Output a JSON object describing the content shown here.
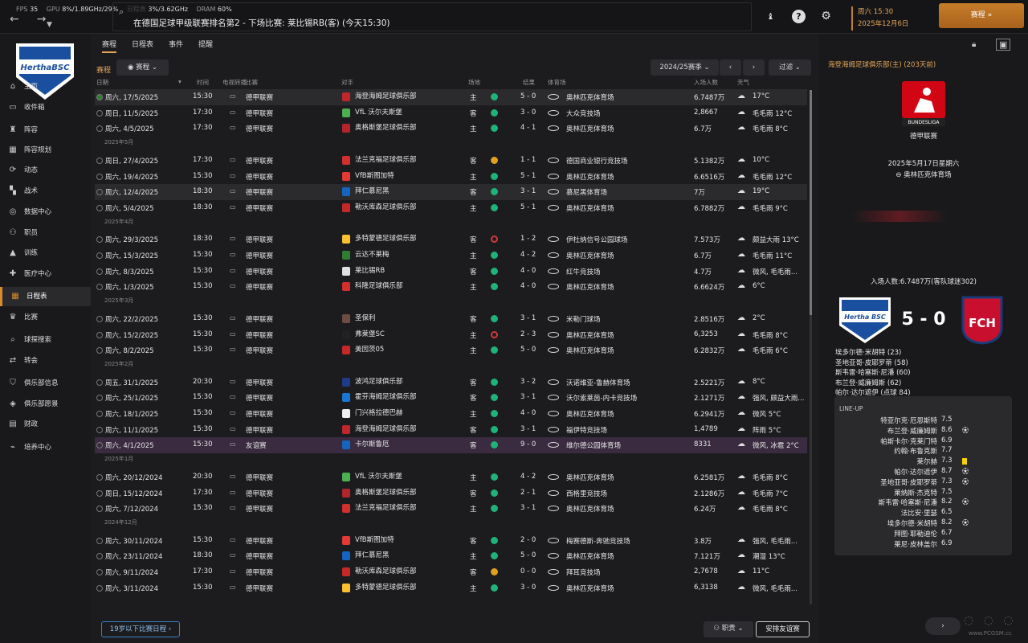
{
  "topbar": {
    "fps_label": "FPS",
    "fps_value": "35",
    "gpu_label": "GPU",
    "gpu_value": "8%/1.89GHz/29%",
    "gpu_mem_value": "3%/3.62GHz",
    "dram_label": "DRAM",
    "dram_value": "60%",
    "faded_text": "日程表",
    "headline": "在德国足球甲级联赛排名第2 - 下场比赛: 莱比锡RB(客) (今天15:30)",
    "weekday_time": "周六 15:30",
    "date": "2025年12月6日",
    "continue_label": "赛程",
    "continue_arrows": "»"
  },
  "sidebar": {
    "items": [
      {
        "label": "主页",
        "icon": "home-icon",
        "glyph": "⌂"
      },
      {
        "label": "收件箱",
        "icon": "inbox-icon",
        "glyph": "▭"
      },
      {
        "label": "阵容",
        "icon": "shirt-icon",
        "glyph": "♜"
      },
      {
        "label": "阵容规划",
        "icon": "planning-icon",
        "glyph": "▦"
      },
      {
        "label": "动态",
        "icon": "dynamics-icon",
        "glyph": "⟳"
      },
      {
        "label": "战术",
        "icon": "tactics-icon",
        "glyph": "▚"
      },
      {
        "label": "数据中心",
        "icon": "data-hub-icon",
        "glyph": "◎"
      },
      {
        "label": "职员",
        "icon": "staff-icon",
        "glyph": "⚇"
      },
      {
        "label": "训练",
        "icon": "training-icon",
        "glyph": "▲"
      },
      {
        "label": "医疗中心",
        "icon": "medical-icon",
        "glyph": "✚"
      },
      {
        "label": "日程表",
        "icon": "calendar-icon",
        "glyph": "▦"
      },
      {
        "label": "比赛",
        "icon": "trophy-icon",
        "glyph": "♛"
      },
      {
        "label": "球探搜索",
        "icon": "scouting-icon",
        "glyph": "⌕"
      },
      {
        "label": "转会",
        "icon": "transfers-icon",
        "glyph": "⇄"
      },
      {
        "label": "俱乐部信息",
        "icon": "club-info-icon",
        "glyph": "⛉"
      },
      {
        "label": "俱乐部愿景",
        "icon": "club-vision-icon",
        "glyph": "◈"
      },
      {
        "label": "财政",
        "icon": "finances-icon",
        "glyph": "▤"
      },
      {
        "label": "培养中心",
        "icon": "development-icon",
        "glyph": "⌁"
      }
    ]
  },
  "tabs": [
    "赛程",
    "日程表",
    "事件",
    "提醒"
  ],
  "section": {
    "title": "赛程",
    "view_dropdown": "赛程",
    "season": "2024/25赛季",
    "filter": "过滤"
  },
  "columns": {
    "date": "日期",
    "time": "时间",
    "tv": "电视转播",
    "competition": "比赛",
    "opponent": "对手",
    "venue": "场地",
    "result": "结果",
    "stadium": "体育场",
    "attendance": "入场人数",
    "weather": "天气"
  },
  "fixtures": [
    {
      "date": "周六, 17/5/2025",
      "time": "15:30",
      "comp": "德甲联赛",
      "opp": "海登海姆足球俱乐部",
      "venue": "主",
      "outcome": "W",
      "score": "5 - 0",
      "stadium": "奥林匹克体育场",
      "att": "6.7487万",
      "weather": "17°C",
      "hl": true,
      "badge": "#c0272d"
    },
    {
      "date": "周日, 11/5/2025",
      "time": "17:30",
      "comp": "德甲联赛",
      "opp": "VfL 沃尔夫斯堡",
      "venue": "客",
      "outcome": "W",
      "score": "3 - 0",
      "stadium": "大众竞技场",
      "att": "2,8667",
      "weather": "毛毛雨 12°C",
      "badge": "#4caf50"
    },
    {
      "date": "周六, 4/5/2025",
      "time": "17:30",
      "comp": "德甲联赛",
      "opp": "奥格斯堡足球俱乐部",
      "venue": "主",
      "outcome": "W",
      "score": "4 - 1",
      "stadium": "奥林匹克体育场",
      "att": "6.7万",
      "weather": "毛毛雨 8°C",
      "badge": "#b3242b"
    },
    {
      "month": "2025年5月"
    },
    {
      "date": "周日, 27/4/2025",
      "time": "17:30",
      "comp": "德甲联赛",
      "opp": "法兰克福足球俱乐部",
      "venue": "客",
      "outcome": "D",
      "score": "1 - 1",
      "stadium": "德国商业银行竞技场",
      "att": "5.1382万",
      "weather": "10°C",
      "badge": "#d32f2f"
    },
    {
      "date": "周六, 19/4/2025",
      "time": "15:30",
      "comp": "德甲联赛",
      "opp": "VfB斯图加特",
      "venue": "主",
      "outcome": "W",
      "score": "5 - 1",
      "stadium": "奥林匹克体育场",
      "att": "6.6516万",
      "weather": "毛毛雨 12°C",
      "badge": "#e53935"
    },
    {
      "date": "周六, 12/4/2025",
      "time": "18:30",
      "comp": "德甲联赛",
      "opp": "拜仁慕尼黑",
      "venue": "客",
      "outcome": "W",
      "score": "3 - 1",
      "stadium": "慕尼黑体育场",
      "att": "7万",
      "weather": "19°C",
      "hl": true,
      "badge": "#1565c0"
    },
    {
      "date": "周六, 5/4/2025",
      "time": "18:30",
      "comp": "德甲联赛",
      "opp": "勒沃库森足球俱乐部",
      "venue": "主",
      "outcome": "W",
      "score": "5 - 1",
      "stadium": "奥林匹克体育场",
      "att": "6.7882万",
      "weather": "毛毛雨 9°C",
      "badge": "#c62828"
    },
    {
      "month": "2025年4月"
    },
    {
      "date": "周六, 29/3/2025",
      "time": "18:30",
      "comp": "德甲联赛",
      "opp": "多特蒙德足球俱乐部",
      "venue": "客",
      "outcome": "L",
      "score": "1 - 2",
      "stadium": "伊杜纳信号公园球场",
      "att": "7.573万",
      "weather": "颇益大雨 13°C",
      "badge": "#fbc02d"
    },
    {
      "date": "周六, 15/3/2025",
      "time": "15:30",
      "comp": "德甲联赛",
      "opp": "云达不莱梅",
      "venue": "主",
      "outcome": "W",
      "score": "4 - 2",
      "stadium": "奥林匹克体育场",
      "att": "6.7万",
      "weather": "毛毛雨 11°C",
      "badge": "#2e7d32"
    },
    {
      "date": "周六, 8/3/2025",
      "time": "15:30",
      "comp": "德甲联赛",
      "opp": "莱比锡RB",
      "venue": "客",
      "outcome": "W",
      "score": "4 - 0",
      "stadium": "红牛竞技场",
      "att": "4.7万",
      "weather": "微风, 毛毛雨...",
      "badge": "#e0e0e0"
    },
    {
      "date": "周六, 1/3/2025",
      "time": "15:30",
      "comp": "德甲联赛",
      "opp": "科隆足球俱乐部",
      "venue": "主",
      "outcome": "W",
      "score": "4 - 0",
      "stadium": "奥林匹克体育场",
      "att": "6.6624万",
      "weather": "6°C",
      "badge": "#d32f2f"
    },
    {
      "month": "2025年3月"
    },
    {
      "date": "周六, 22/2/2025",
      "time": "15:30",
      "comp": "德甲联赛",
      "opp": "圣保利",
      "venue": "客",
      "outcome": "W",
      "score": "3 - 1",
      "stadium": "米勒门球场",
      "att": "2.8516万",
      "weather": "2°C",
      "badge": "#6d4c41"
    },
    {
      "date": "周六, 15/2/2025",
      "time": "15:30",
      "comp": "德甲联赛",
      "opp": "弗莱堡SC",
      "venue": "主",
      "outcome": "L",
      "score": "2 - 3",
      "stadium": "奥林匹克体育场",
      "att": "6,3253",
      "weather": "毛毛雨 8°C",
      "badge": "#212121"
    },
    {
      "date": "周六, 8/2/2025",
      "time": "15:30",
      "comp": "德甲联赛",
      "opp": "美因茨05",
      "venue": "主",
      "outcome": "W",
      "score": "5 - 0",
      "stadium": "奥林匹克体育场",
      "att": "6.2832万",
      "weather": "毛毛雨 6°C",
      "badge": "#c62828"
    },
    {
      "month": "2025年2月"
    },
    {
      "date": "周五, 31/1/2025",
      "time": "20:30",
      "comp": "德甲联赛",
      "opp": "波鸿足球俱乐部",
      "venue": "客",
      "outcome": "W",
      "score": "3 - 2",
      "stadium": "沃诺维亚-鲁赫体育场",
      "att": "2.5221万",
      "weather": "8°C",
      "badge": "#1e3a8a"
    },
    {
      "date": "周六, 25/1/2025",
      "time": "15:30",
      "comp": "德甲联赛",
      "opp": "霍芬海姆足球俱乐部",
      "venue": "客",
      "outcome": "W",
      "score": "3 - 1",
      "stadium": "沃尔索莱茵-内卡竞技场",
      "att": "2.1271万",
      "weather": "强风, 颇益大雨...",
      "badge": "#1976d2"
    },
    {
      "date": "周六, 18/1/2025",
      "time": "15:30",
      "comp": "德甲联赛",
      "opp": "门兴格拉德巴赫",
      "venue": "主",
      "outcome": "W",
      "score": "4 - 0",
      "stadium": "奥林匹克体育场",
      "att": "6.2941万",
      "weather": "微风 5°C",
      "badge": "#eeeeee"
    },
    {
      "date": "周六, 11/1/2025",
      "time": "15:30",
      "comp": "德甲联赛",
      "opp": "海登海姆足球俱乐部",
      "venue": "客",
      "outcome": "W",
      "score": "3 - 1",
      "stadium": "福伊特竞技场",
      "att": "1,4789",
      "weather": "阵雨 5°C",
      "badge": "#c0272d"
    },
    {
      "date": "周六, 4/1/2025",
      "time": "15:30",
      "comp": "友谊赛",
      "opp": "卡尔斯鲁厄",
      "venue": "客",
      "outcome": "W",
      "score": "9 - 0",
      "stadium": "维尔德公园体育场",
      "att": "8331",
      "weather": "微风, 冰雹 2°C",
      "purple": true,
      "badge": "#1565c0"
    },
    {
      "month": "2025年1月"
    },
    {
      "date": "周六, 20/12/2024",
      "time": "20:30",
      "comp": "德甲联赛",
      "opp": "VfL 沃尔夫斯堡",
      "venue": "主",
      "outcome": "W",
      "score": "4 - 2",
      "stadium": "奥林匹克体育场",
      "att": "6.2581万",
      "weather": "毛毛雨 8°C",
      "badge": "#4caf50"
    },
    {
      "date": "周日, 15/12/2024",
      "time": "17:30",
      "comp": "德甲联赛",
      "opp": "奥格斯堡足球俱乐部",
      "venue": "客",
      "outcome": "W",
      "score": "2 - 1",
      "stadium": "西格里竞技场",
      "att": "2.1286万",
      "weather": "毛毛雨 7°C",
      "badge": "#b3242b"
    },
    {
      "date": "周六, 7/12/2024",
      "time": "15:30",
      "comp": "德甲联赛",
      "opp": "法兰克福足球俱乐部",
      "venue": "主",
      "outcome": "W",
      "score": "3 - 1",
      "stadium": "奥林匹克体育场",
      "att": "6.24万",
      "weather": "毛毛雨 8°C",
      "badge": "#d32f2f"
    },
    {
      "month": "2024年12月"
    },
    {
      "date": "周六, 30/11/2024",
      "time": "15:30",
      "comp": "德甲联赛",
      "opp": "VfB斯图加特",
      "venue": "客",
      "outcome": "W",
      "score": "2 - 0",
      "stadium": "梅赛德斯-奔驰竞技场",
      "att": "3.8万",
      "weather": "强风, 毛毛雨...",
      "badge": "#e53935"
    },
    {
      "date": "周六, 23/11/2024",
      "time": "18:30",
      "comp": "德甲联赛",
      "opp": "拜仁慕尼黑",
      "venue": "主",
      "outcome": "W",
      "score": "5 - 0",
      "stadium": "奥林匹克体育场",
      "att": "7.121万",
      "weather": "潮湿 13°C",
      "badge": "#1565c0"
    },
    {
      "date": "周六, 9/11/2024",
      "time": "17:30",
      "comp": "德甲联赛",
      "opp": "勒沃库森足球俱乐部",
      "venue": "客",
      "outcome": "D",
      "score": "0 - 0",
      "stadium": "拜耳竞技场",
      "att": "2,7678",
      "weather": "11°C",
      "badge": "#c62828"
    },
    {
      "date": "周六, 3/11/2024",
      "time": "15:30",
      "comp": "德甲联赛",
      "opp": "多特蒙德足球俱乐部",
      "venue": "主",
      "outcome": "W",
      "score": "3 - 0",
      "stadium": "奥林匹克体育场",
      "att": "6,3138",
      "weather": "微风, 毛毛雨...",
      "badge": "#fbc02d"
    }
  ],
  "bottom": {
    "youth_button": "19岁以下比赛日程",
    "staff_dropdown": "职责",
    "arrange_button": "安排友谊赛"
  },
  "match_panel": {
    "title": "海登海姆足球俱乐部(主) (203天前)",
    "league_logo_text": "BUNDESLIGA",
    "league": "德甲联赛",
    "date": "2025年5月17日星期六",
    "stadium": "奥林匹克体育场",
    "attendance": "入场人数:6.7487万(客队球迷302)",
    "home_crest_text": "Hertha BSC",
    "score": "5 - 0",
    "away_crest_text": "FCH",
    "scorers": [
      "埃多尔德·米胡特 (23)",
      "圣地亚哥·皮耶罗蒂 (58)",
      "斯韦雷·哈塞斯·尼潘 (60)",
      "布兰登·威廉姆斯 (62)",
      "帕尔·达尔遮伊 (点球 84)"
    ],
    "lineup_title": "LINE-UP",
    "lineup": [
      {
        "name": "特亚尔克·厄恩斯特",
        "rating": "7.5",
        "icon": ""
      },
      {
        "name": "布兰登·威廉姆斯",
        "rating": "8.6",
        "icon": "ball"
      },
      {
        "name": "帕斯卡尔·克莱门特",
        "rating": "6.9",
        "icon": ""
      },
      {
        "name": "约翰·布鲁克斯",
        "rating": "7.7",
        "icon": ""
      },
      {
        "name": "莱尔赫",
        "rating": "7.3",
        "icon": "yellow"
      },
      {
        "name": "帕尔·达尔遮伊",
        "rating": "8.7",
        "icon": "ball"
      },
      {
        "name": "圣地亚哥·皮耶罗蒂",
        "rating": "7.3",
        "icon": "ball"
      },
      {
        "name": "莱纳斯·杰克特",
        "rating": "7.5",
        "icon": ""
      },
      {
        "name": "斯韦雷·哈塞斯·尼潘",
        "rating": "8.2",
        "icon": "ball"
      },
      {
        "name": "法比安·里瑟",
        "rating": "6.5",
        "icon": ""
      },
      {
        "name": "埃多尔德·米胡特",
        "rating": "8.2",
        "icon": "ball"
      },
      {
        "name": "拜图·耶勒迪伦",
        "rating": "6.7",
        "icon": ""
      },
      {
        "name": "莱尼·皮林盖尔",
        "rating": "6.9",
        "icon": ""
      }
    ]
  },
  "watermark": "www.PCGSM.cc",
  "colors": {
    "accent": "#e3a65a",
    "win": "#1fb37a",
    "draw": "#e0a020",
    "loss": "#d23a3a",
    "friendly_row": "#3a2b40"
  }
}
